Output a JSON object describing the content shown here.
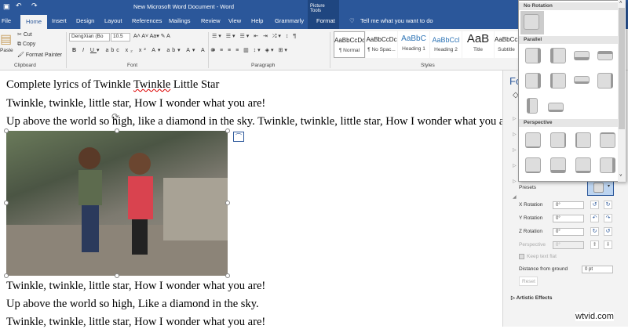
{
  "title": "New Microsoft Word Document - Word",
  "contextual_tab_group": "Picture Tools",
  "tabs": [
    "File",
    "Home",
    "Insert",
    "Design",
    "Layout",
    "References",
    "Mailings",
    "Review",
    "View",
    "Help",
    "Grammarly",
    "Format"
  ],
  "tell_me": "Tell me what you want to do",
  "clipboard": {
    "paste": "Paste",
    "cut": "Cut",
    "copy": "Copy",
    "format_painter": "Format Painter",
    "label": "Clipboard"
  },
  "font": {
    "name": "DengXian (Bo",
    "size": "10.5",
    "label": "Font"
  },
  "paragraph": {
    "label": "Paragraph"
  },
  "styles": {
    "label": "Styles",
    "items": [
      {
        "preview": "AaBbCcDc",
        "name": "¶ Normal"
      },
      {
        "preview": "AaBbCcDc",
        "name": "¶ No Spac..."
      },
      {
        "preview": "AaBbC",
        "name": "Heading 1"
      },
      {
        "preview": "AaBbCcl",
        "name": "Heading 2"
      },
      {
        "preview": "AaB",
        "name": "Title"
      },
      {
        "preview": "AaBbCcD",
        "name": "Subtitle"
      }
    ]
  },
  "document": {
    "heading_pre": "Complete lyrics of Twinkle ",
    "heading_err": "Twinkle",
    "heading_post": " Little Star",
    "lines_before": [
      "Twinkle, twinkle, little star, How I wonder what you are!",
      "Up above the world so high, like a diamond in the sky. Twinkle, twinkle, little star, How I wonder what you are!"
    ],
    "lines_after": [
      "Twinkle, twinkle, little star, How I wonder what you are!",
      "Up above the world so high, Like a diamond in the sky.",
      "Twinkle, twinkle, little star, How I wonder what you are!"
    ]
  },
  "pane": {
    "title": "Fo",
    "presets": "Presets",
    "x_rotation": "X Rotation",
    "x_val": "0°",
    "y_rotation": "Y Rotation",
    "y_val": "0°",
    "z_rotation": "Z Rotation",
    "z_val": "0°",
    "perspective": "Perspective",
    "p_val": "0°",
    "keep_flat": "Keep text flat",
    "distance": "Distance from ground",
    "distance_val": "0 pt",
    "reset": "Reset",
    "artistic": "Artistic Effects"
  },
  "gallery": {
    "no_rotation": "No Rotation",
    "parallel": "Parallel",
    "perspective": "Perspective"
  },
  "watermark": "wtvid.com",
  "colors": {
    "accent": "#2b579a"
  }
}
